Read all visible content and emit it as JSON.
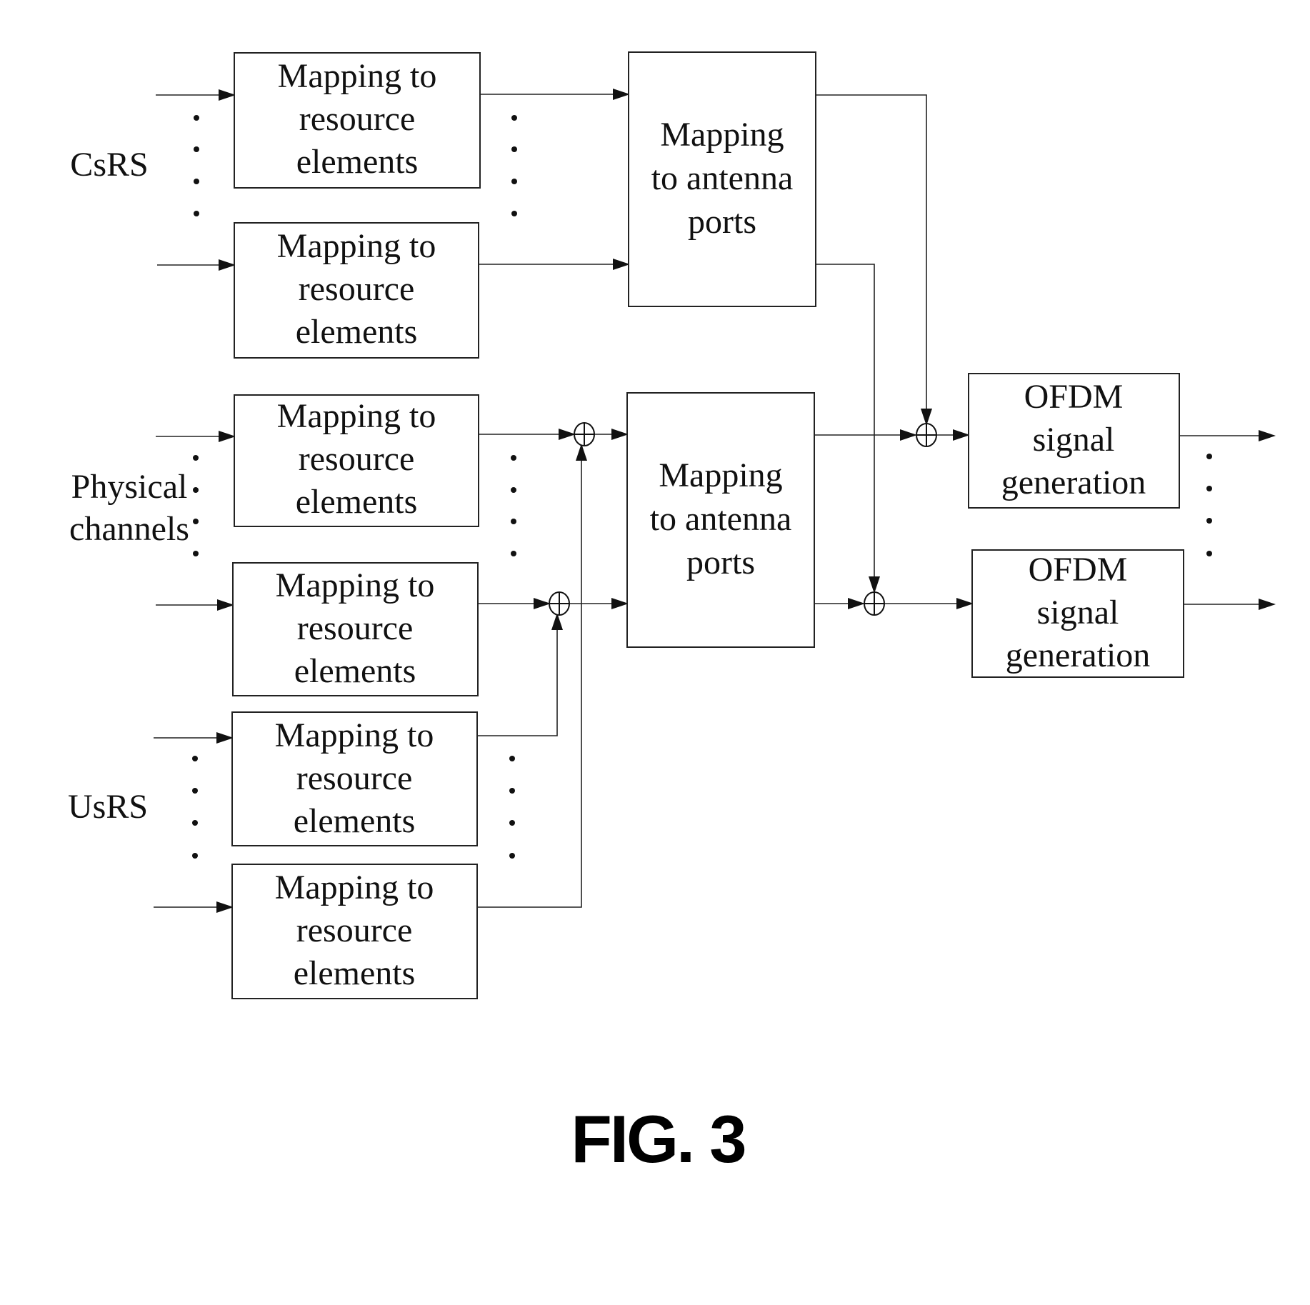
{
  "figure": {
    "caption": "FIG. 3"
  },
  "groups": {
    "csrs": {
      "label_lines": [
        "CsRS"
      ]
    },
    "physical": {
      "label_lines": [
        "Physical",
        "channels"
      ]
    },
    "usrs": {
      "label_lines": [
        "UsRS"
      ]
    }
  },
  "blocks": {
    "re_csrs_1": {
      "lines": [
        "Mapping to",
        "resource",
        "elements"
      ]
    },
    "re_csrs_2": {
      "lines": [
        "Mapping to",
        "resource",
        "elements"
      ]
    },
    "re_phys_1": {
      "lines": [
        "Mapping to",
        "resource",
        "elements"
      ]
    },
    "re_phys_2": {
      "lines": [
        "Mapping to",
        "resource",
        "elements"
      ]
    },
    "re_usrs_1": {
      "lines": [
        "Mapping to",
        "resource",
        "elements"
      ]
    },
    "re_usrs_2": {
      "lines": [
        "Mapping to",
        "resource",
        "elements"
      ]
    },
    "ap_1": {
      "lines": [
        "Mapping",
        "to antenna",
        "ports"
      ]
    },
    "ap_2": {
      "lines": [
        "Mapping",
        "to antenna",
        "ports"
      ]
    },
    "ofdm_1": {
      "lines": [
        "OFDM",
        "signal",
        "generation"
      ]
    },
    "ofdm_2": {
      "lines": [
        "OFDM",
        "signal",
        "generation"
      ]
    }
  },
  "symbols": {
    "adder": "circled-plus",
    "ellipsis": "vertical-dots"
  }
}
